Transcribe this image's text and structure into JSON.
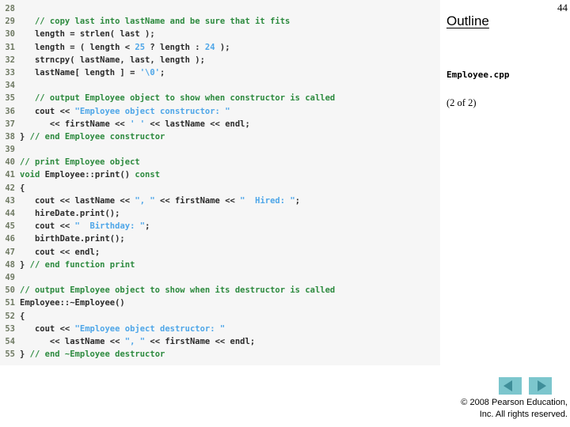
{
  "slide": {
    "page_number": "44",
    "outline_heading": "Outline",
    "file_name": "Employee.cpp",
    "part_label": "(2 of 2)"
  },
  "nav": {
    "prev_label": "previous-slide",
    "next_label": "next-slide",
    "arrow_fill": "#7cc6cd",
    "arrow_glyph": "#3f8e99"
  },
  "footer": {
    "line1": "© 2008 Pearson Education,",
    "line2": "Inc.  All rights reserved."
  },
  "colors": {
    "panel_bg": "#f6f6f6",
    "comment": "#2c8a3e",
    "string": "#4ea6e8",
    "number": "#4ea6e8",
    "code": "#2b2b2b",
    "line_number": "#6f7a63"
  },
  "code": {
    "language": "cpp",
    "first_line_number": 28,
    "last_line_number": 55,
    "lines": [
      {
        "n": "28",
        "tokens": []
      },
      {
        "n": "29",
        "tokens": [
          {
            "t": "   // copy last into lastName and be sure that it fits",
            "c": "cm"
          }
        ]
      },
      {
        "n": "30",
        "tokens": [
          {
            "t": "   length = strlen( last );",
            "c": "kw"
          }
        ]
      },
      {
        "n": "31",
        "tokens": [
          {
            "t": "   length = ( length < ",
            "c": "kw"
          },
          {
            "t": "25",
            "c": "nm"
          },
          {
            "t": " ? length : ",
            "c": "kw"
          },
          {
            "t": "24",
            "c": "nm"
          },
          {
            "t": " );",
            "c": "kw"
          }
        ]
      },
      {
        "n": "32",
        "tokens": [
          {
            "t": "   strncpy( lastName, last, length );",
            "c": "kw"
          }
        ]
      },
      {
        "n": "33",
        "tokens": [
          {
            "t": "   lastName[ length ] = ",
            "c": "kw"
          },
          {
            "t": "'\\0'",
            "c": "st"
          },
          {
            "t": ";",
            "c": "kw"
          }
        ]
      },
      {
        "n": "34",
        "tokens": []
      },
      {
        "n": "35",
        "tokens": [
          {
            "t": "   // output Employee object to show when constructor is called",
            "c": "cm"
          }
        ]
      },
      {
        "n": "36",
        "tokens": [
          {
            "t": "   cout << ",
            "c": "kw"
          },
          {
            "t": "\"Employee object constructor: \"",
            "c": "st"
          }
        ]
      },
      {
        "n": "37",
        "tokens": [
          {
            "t": "      << firstName << ",
            "c": "kw"
          },
          {
            "t": "' '",
            "c": "st"
          },
          {
            "t": " << lastName << endl;",
            "c": "kw"
          }
        ]
      },
      {
        "n": "38",
        "tokens": [
          {
            "t": "} ",
            "c": "kw"
          },
          {
            "t": "// end Employee constructor",
            "c": "cm"
          }
        ]
      },
      {
        "n": "39",
        "tokens": []
      },
      {
        "n": "40",
        "tokens": [
          {
            "t": "// print Employee object",
            "c": "cm"
          }
        ]
      },
      {
        "n": "41",
        "tokens": [
          {
            "t": "void",
            "c": "cm"
          },
          {
            "t": " Employee::print() ",
            "c": "kw"
          },
          {
            "t": "const",
            "c": "cm"
          }
        ]
      },
      {
        "n": "42",
        "tokens": [
          {
            "t": "{",
            "c": "kw"
          }
        ]
      },
      {
        "n": "43",
        "tokens": [
          {
            "t": "   cout << lastName << ",
            "c": "kw"
          },
          {
            "t": "\", \"",
            "c": "st"
          },
          {
            "t": " << firstName << ",
            "c": "kw"
          },
          {
            "t": "\"  Hired: \"",
            "c": "st"
          },
          {
            "t": ";",
            "c": "kw"
          }
        ]
      },
      {
        "n": "44",
        "tokens": [
          {
            "t": "   hireDate.print();",
            "c": "kw"
          }
        ]
      },
      {
        "n": "45",
        "tokens": [
          {
            "t": "   cout << ",
            "c": "kw"
          },
          {
            "t": "\"  Birthday: \"",
            "c": "st"
          },
          {
            "t": ";",
            "c": "kw"
          }
        ]
      },
      {
        "n": "46",
        "tokens": [
          {
            "t": "   birthDate.print();",
            "c": "kw"
          }
        ]
      },
      {
        "n": "47",
        "tokens": [
          {
            "t": "   cout << endl;",
            "c": "kw"
          }
        ]
      },
      {
        "n": "48",
        "tokens": [
          {
            "t": "} ",
            "c": "kw"
          },
          {
            "t": "// end function print",
            "c": "cm"
          }
        ]
      },
      {
        "n": "49",
        "tokens": []
      },
      {
        "n": "50",
        "tokens": [
          {
            "t": "// output Employee object to show when its destructor is called",
            "c": "cm"
          }
        ]
      },
      {
        "n": "51",
        "tokens": [
          {
            "t": "Employee::~Employee()",
            "c": "kw"
          }
        ]
      },
      {
        "n": "52",
        "tokens": [
          {
            "t": "{",
            "c": "kw"
          }
        ]
      },
      {
        "n": "53",
        "tokens": [
          {
            "t": "   cout << ",
            "c": "kw"
          },
          {
            "t": "\"Employee object destructor: \"",
            "c": "st"
          }
        ]
      },
      {
        "n": "54",
        "tokens": [
          {
            "t": "      << lastName << ",
            "c": "kw"
          },
          {
            "t": "\", \"",
            "c": "st"
          },
          {
            "t": " << firstName << endl;",
            "c": "kw"
          }
        ]
      },
      {
        "n": "55",
        "tokens": [
          {
            "t": "} ",
            "c": "kw"
          },
          {
            "t": "// end ~Employee destructor",
            "c": "cm"
          }
        ]
      }
    ]
  }
}
